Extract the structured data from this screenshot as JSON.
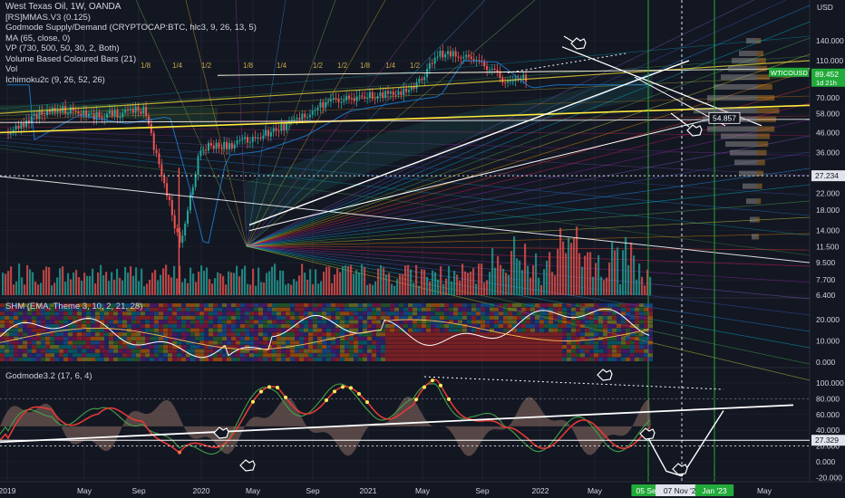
{
  "header": {
    "title": "West Texas Oil, 1W, OANDA",
    "indicators": [
      "[RS]MMAS.V3 (0.125)",
      "Godmode Supply/Demand (CRYPTOCAP:BTC, hlc3, 9, 26, 13, 5)",
      "MA (65, close, 0)",
      "VP (730, 500, 50, 30, 2, Both)",
      "Volume Based Coloured Bars (21)",
      "Vol",
      "Ichimoku2c (9, 26, 52, 26)"
    ]
  },
  "colors": {
    "background": "#131722",
    "grid": "#1f2331",
    "text": "#d1d4dc",
    "up": "#26a69a",
    "down": "#ef5350",
    "green_line": "#4caf50",
    "red_line": "#e53935",
    "yellow_line": "#ffeb3b",
    "white_line": "#ffffff",
    "accent_green": "#22ab3a"
  },
  "price_pane": {
    "currency": "USD",
    "axis_labels": [
      "140.000",
      "110.000",
      "90.000",
      "70.000",
      "58.000",
      "46.000",
      "36.000",
      "27.234",
      "22.000",
      "18.000",
      "14.000",
      "11.500",
      "9.500",
      "7.700",
      "6.400"
    ],
    "ticker_label": "WTICOUSD",
    "last_price": "89.452",
    "countdown": "1d 21h",
    "target_label": "54.857",
    "level_label": "27.234",
    "fib_labels": [
      "1/8",
      "1/4",
      "1/2",
      "1/8",
      "1/4",
      "1/2",
      "1/2",
      "1/8",
      "1/4",
      "1/2"
    ]
  },
  "shm_pane": {
    "title": "SHM (EMA, Theme 3, 10, 2, 21, 28)",
    "axis_labels": [
      "20.000",
      "10.000",
      "0.000"
    ]
  },
  "godmode_pane": {
    "title": "Godmode3.2 (17, 6, 4)",
    "axis_labels": [
      "100.000",
      "80.000",
      "60.000",
      "40.000",
      "20.000",
      "0.000",
      "-20.000"
    ],
    "level_label": "27.329"
  },
  "time_axis": {
    "labels": [
      "2019",
      "May",
      "Sep",
      "2020",
      "May",
      "Sep",
      "2021",
      "May",
      "Sep",
      "2022",
      "May",
      "05 Sep",
      "07 Nov '22",
      "Jan '23",
      "May"
    ]
  },
  "chart_data": {
    "type": "candlestick",
    "symbol": "West Texas Oil",
    "interval": "1W",
    "exchange": "OANDA",
    "last_price": 89.452,
    "marked_levels": [
      54.857,
      27.234
    ],
    "oscillator_level": 27.329,
    "price_path": [
      {
        "x": "2019",
        "close": 46
      },
      {
        "x": "May 2019",
        "close": 62
      },
      {
        "x": "Sep 2019",
        "close": 56
      },
      {
        "x": "2020",
        "close": 61
      },
      {
        "x": "Mar 2020",
        "close": 22
      },
      {
        "x": "Apr 2020",
        "close": 11.5
      },
      {
        "x": "Jun 2020",
        "close": 38
      },
      {
        "x": "Sep 2020",
        "close": 40
      },
      {
        "x": "2021",
        "close": 48
      },
      {
        "x": "May 2021",
        "close": 65
      },
      {
        "x": "Sep 2021",
        "close": 72
      },
      {
        "x": "2022",
        "close": 78
      },
      {
        "x": "Mar 2022",
        "close": 120
      },
      {
        "x": "Jun 2022",
        "close": 118
      },
      {
        "x": "Sep 2022",
        "close": 86
      },
      {
        "x": "Nov 2022",
        "close": 89.452
      }
    ],
    "godmode_path": [
      {
        "x": "2019",
        "value": 25
      },
      {
        "x": "May 2019",
        "value": 75
      },
      {
        "x": "Sep 2019",
        "value": 45
      },
      {
        "x": "2020",
        "value": 70
      },
      {
        "x": "Apr 2020",
        "value": -5
      },
      {
        "x": "Sep 2020",
        "value": 50
      },
      {
        "x": "2021",
        "value": 85
      },
      {
        "x": "May 2021",
        "value": 75
      },
      {
        "x": "Sep 2021",
        "value": 80
      },
      {
        "x": "2022",
        "value": 60
      },
      {
        "x": "Mar 2022",
        "value": 95
      },
      {
        "x": "Jun 2022",
        "value": 70
      },
      {
        "x": "Sep 2022",
        "value": 25
      },
      {
        "x": "Nov 2022",
        "value": 35
      }
    ],
    "projection": [
      {
        "x": "07 Nov '22",
        "value": 20
      },
      {
        "x": "Dec 2022",
        "value": -15
      },
      {
        "x": "Jan '23",
        "value": 65
      }
    ]
  }
}
